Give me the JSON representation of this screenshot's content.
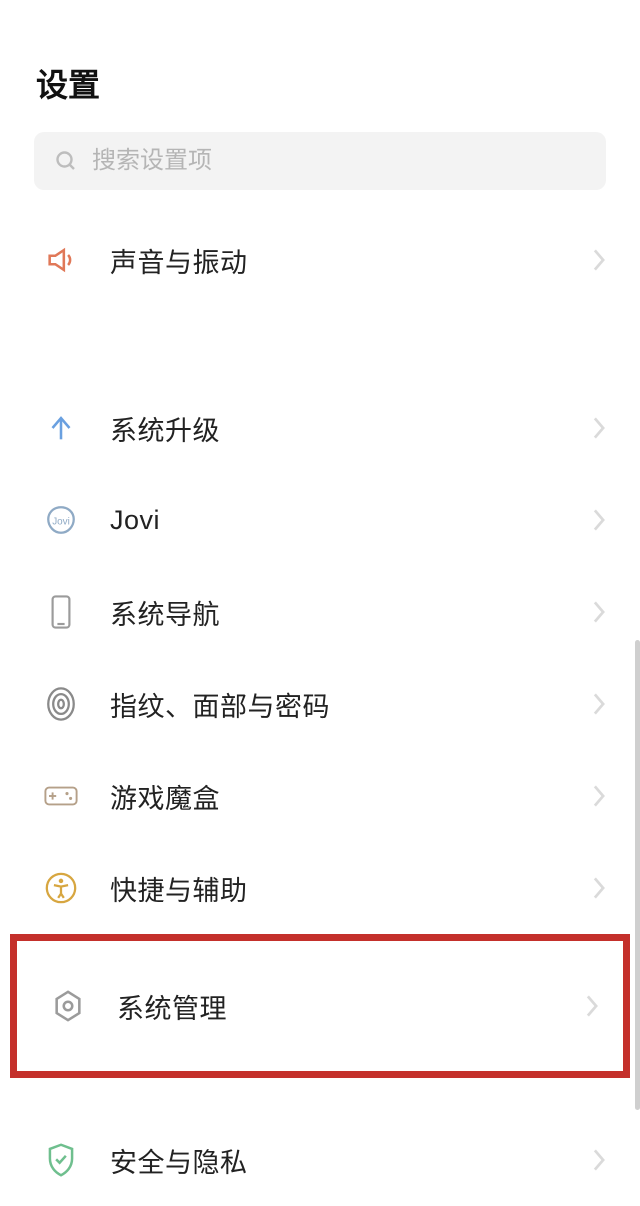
{
  "title": "设置",
  "search": {
    "placeholder": "搜索设置项"
  },
  "sections": [
    {
      "items": [
        {
          "id": "sound",
          "label": "声音与振动",
          "icon": "volume-icon",
          "color": "#e07858"
        }
      ]
    },
    {
      "items": [
        {
          "id": "update",
          "label": "系统升级",
          "icon": "arrow-up-icon",
          "color": "#6aa0e0"
        },
        {
          "id": "jovi",
          "label": "Jovi",
          "icon": "jovi-icon",
          "color": "#8faac5"
        },
        {
          "id": "nav",
          "label": "系统导航",
          "icon": "phone-icon",
          "color": "#9b9b9b"
        },
        {
          "id": "biometrics",
          "label": "指纹、面部与密码",
          "icon": "fingerprint-icon",
          "color": "#8a8a8a"
        },
        {
          "id": "gamebox",
          "label": "游戏魔盒",
          "icon": "gamepad-icon",
          "color": "#b5a089"
        },
        {
          "id": "shortcuts",
          "label": "快捷与辅助",
          "icon": "accessibility-icon",
          "color": "#d7a640"
        },
        {
          "id": "system",
          "label": "系统管理",
          "icon": "hex-gear-icon",
          "color": "#9b9b9b",
          "highlighted": true
        }
      ]
    },
    {
      "items": [
        {
          "id": "security",
          "label": "安全与隐私",
          "icon": "shield-check-icon",
          "color": "#6fbf8e"
        }
      ]
    }
  ]
}
